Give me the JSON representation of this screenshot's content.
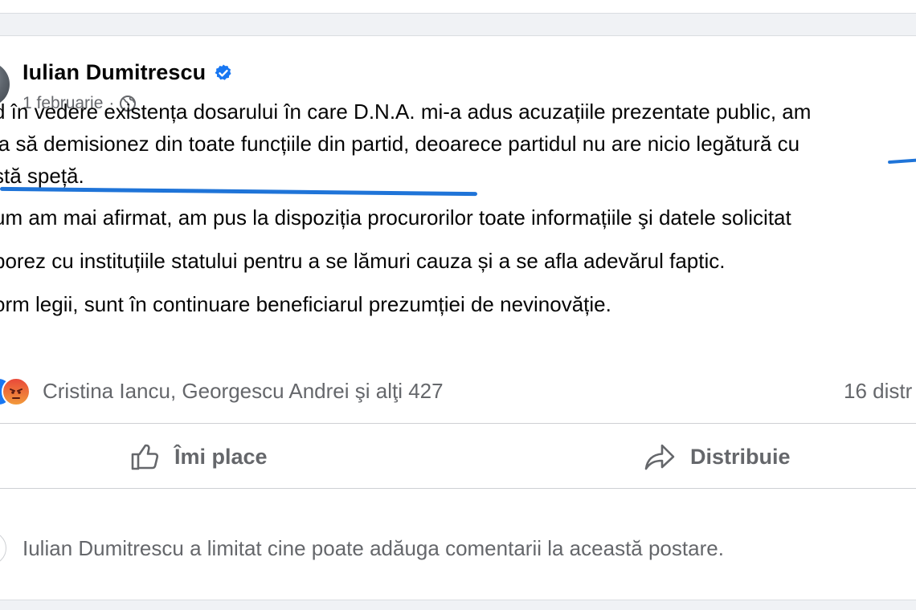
{
  "post": {
    "author": "Iulian Dumitrescu",
    "date": "1 februarie",
    "separator": "·",
    "body_lines": [
      "d în vedere existența dosarului în care D.N.A. mi-a adus acuzațiile prezentate public, am",
      "ia să demisionez din toate funcțiile din partid, deoarece partidul nu are nicio legătură cu",
      "stă speță.",
      "um am mai afirmat, am pus la dispoziția procurorilor toate informațiile şi datele solicitat",
      "borez cu instituțiile statului pentru a se lămuri cauza și a se afla adevărul faptic.",
      "orm legii, sunt în continuare beneficiarul prezumției de nevinovăție."
    ],
    "reactions": {
      "icons": [
        "like-reaction-icon",
        "angry-reaction-icon"
      ],
      "text": "Cristina Iancu, Georgescu Andrei şi alţi 427",
      "shares": "16 distr"
    },
    "actions": {
      "like_label": "Îmi place",
      "share_label": "Distribuie"
    },
    "restriction_notice": "Iulian Dumitrescu a limitat cine poate adăuga comentarii la această postare."
  },
  "colors": {
    "background": "#f0f2f5",
    "card": "#ffffff",
    "secondary_text": "#65676b",
    "underline_highlight": "#1f74d8",
    "verified_badge": "#1877f2"
  }
}
